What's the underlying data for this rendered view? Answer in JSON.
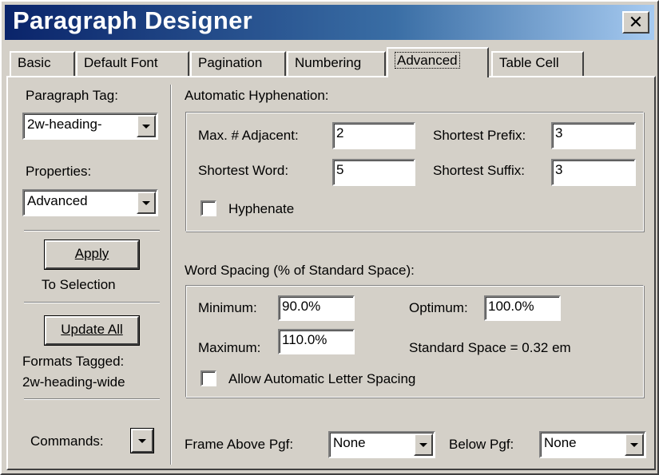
{
  "window": {
    "title": "Paragraph Designer",
    "close_symbol": "✕"
  },
  "tabs": [
    {
      "label": "Basic"
    },
    {
      "label": "Default Font"
    },
    {
      "label": "Pagination"
    },
    {
      "label": "Numbering"
    },
    {
      "label": "Advanced"
    },
    {
      "label": "Table Cell"
    }
  ],
  "active_tab": "Advanced",
  "left": {
    "paragraph_tag_label": "Paragraph Tag:",
    "paragraph_tag_value": "2w-heading-",
    "properties_label": "Properties:",
    "properties_value": "Advanced",
    "apply_button": "Apply",
    "apply_sub": "To Selection",
    "update_all_button": "Update All",
    "formats_tagged_label": "Formats Tagged:",
    "formats_tagged_value": "2w-heading-wide",
    "commands_label": "Commands:"
  },
  "hyphenation": {
    "section_label": "Automatic Hyphenation:",
    "max_adjacent_label": "Max. # Adjacent:",
    "max_adjacent_value": "2",
    "shortest_prefix_label": "Shortest Prefix:",
    "shortest_prefix_value": "3",
    "shortest_word_label": "Shortest Word:",
    "shortest_word_value": "5",
    "shortest_suffix_label": "Shortest Suffix:",
    "shortest_suffix_value": "3",
    "hyphenate_label": "Hyphenate",
    "hyphenate_checked": false
  },
  "word_spacing": {
    "section_label": "Word Spacing (% of Standard Space):",
    "minimum_label": "Minimum:",
    "minimum_value": "90.0%",
    "optimum_label": "Optimum:",
    "optimum_value": "100.0%",
    "maximum_label": "Maximum:",
    "maximum_value": "110.0%",
    "standard_space_text": "Standard Space = 0.32 em",
    "allow_letter_spacing_label": "Allow Automatic Letter Spacing",
    "allow_letter_spacing_checked": false
  },
  "frame": {
    "above_label": "Frame Above Pgf:",
    "above_value": "None",
    "below_label": "Below Pgf:",
    "below_value": "None"
  },
  "icons": {
    "close": "close-icon",
    "dropdown_arrow": "chevron-down-icon"
  },
  "colors": {
    "title_gradient_start": "#0a246a",
    "title_gradient_end": "#a6caf0",
    "face": "#d4d0c8"
  }
}
